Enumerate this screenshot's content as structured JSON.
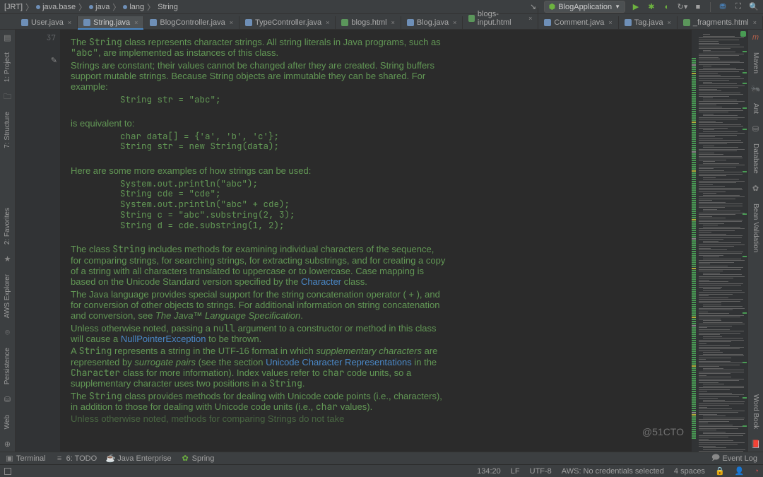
{
  "breadcrumb": {
    "root": "[JRT]",
    "p1": "java.base",
    "p2": "java",
    "p3": "lang",
    "cls": "String"
  },
  "run_config": "BlogApplication",
  "tabs": [
    {
      "label": "User.java",
      "kind": "java"
    },
    {
      "label": "String.java",
      "kind": "java",
      "active": true
    },
    {
      "label": "BlogController.java",
      "kind": "java"
    },
    {
      "label": "TypeController.java",
      "kind": "java"
    },
    {
      "label": "blogs.html",
      "kind": "html"
    },
    {
      "label": "Blog.java",
      "kind": "java"
    },
    {
      "label": "blogs-input.html",
      "kind": "html"
    },
    {
      "label": "Comment.java",
      "kind": "java"
    },
    {
      "label": "Tag.java",
      "kind": "java"
    },
    {
      "label": "_fragments.html",
      "kind": "html"
    }
  ],
  "gutter": {
    "line": "37"
  },
  "left_rail": {
    "project": "1: Project",
    "structure": "7: Structure",
    "favorites": "2: Favorites",
    "aws": "AWS Explorer",
    "persist": "Persistence",
    "web": "Web"
  },
  "right_rail": {
    "maven": "Maven",
    "ant": "Ant",
    "database": "Database",
    "bean": "Bean Validation",
    "wordbook": "Word Book"
  },
  "doc": {
    "para1a": "The ",
    "para1b": " class represents character strings. All string literals in Java programs, such as ",
    "para1c": ", are implemented as instances of this class.",
    "abc": "\"abc\"",
    "para2": "Strings are constant; their values cannot be changed after they are created. String buffers support mutable strings. Because String objects are immutable they can be shared. For example:",
    "code1": "String str = \"abc\";",
    "equiv": "is equivalent to:",
    "code2": "char data[] = {'a', 'b', 'c'};\nString str = new String(data);",
    "examples": "Here are some more examples of how strings can be used:",
    "code3": "System.out.println(\"abc\");\nString cde = \"cde\";\nSystem.out.println(\"abc\" + cde);\nString c = \"abc\".substring(2, 3);\nString d = cde.substring(1, 2);",
    "para3a": "The class ",
    "para3b": " includes methods for examining individual characters of the sequence, for comparing strings, for searching strings, for extracting substrings, and for creating a copy of a string with all characters translated to uppercase or to lowercase. Case mapping is based on the Unicode Standard version specified by the ",
    "character_link": "Character",
    "para3c": " class.",
    "para4a": "The Java language provides special support for the string concatenation operator ( + ), and for conversion of other objects to strings. For additional information on string concatenation and conversion, see ",
    "jls": "The Java™ Language Specification",
    "para4b": ".",
    "para5a": "Unless otherwise noted, passing a ",
    "null": "null",
    "para5b": " argument to a constructor or method in this class will cause a ",
    "npe": "NullPointerException",
    "para5c": " to be thrown.",
    "para6a": "A ",
    "para6b": " represents a string in the UTF-16 format in which ",
    "supp": "supplementary characters",
    "para6c": " are represented by ",
    "surr": "surrogate pairs",
    "para6d": " (see the section ",
    "ucr": "Unicode Character Representations",
    "para6e": " in the ",
    "para6f": " class for more information). Index values refer to ",
    "char": "char",
    "para6g": " code units, so a supplementary character uses two positions in a ",
    "para6h": ".",
    "para7a": "The ",
    "para7b": " class provides methods for dealing with Unicode code points (i.e., characters), in addition to those for dealing with Unicode code units (i.e., ",
    "para7c": " values).",
    "para8": "Unless otherwise noted, methods for comparing Strings do not take",
    "string": "String",
    "characterk": "Character"
  },
  "tool_tabs": {
    "terminal": "Terminal",
    "todo": "6: TODO",
    "javaee": "Java Enterprise",
    "spring": "Spring"
  },
  "status": {
    "pos": "134:20",
    "le": "LF",
    "enc": "UTF-8",
    "aws": "AWS: No credentials selected",
    "spaces": "4 spaces",
    "eventlog": "Event Log"
  },
  "watermark": "@51CTO"
}
